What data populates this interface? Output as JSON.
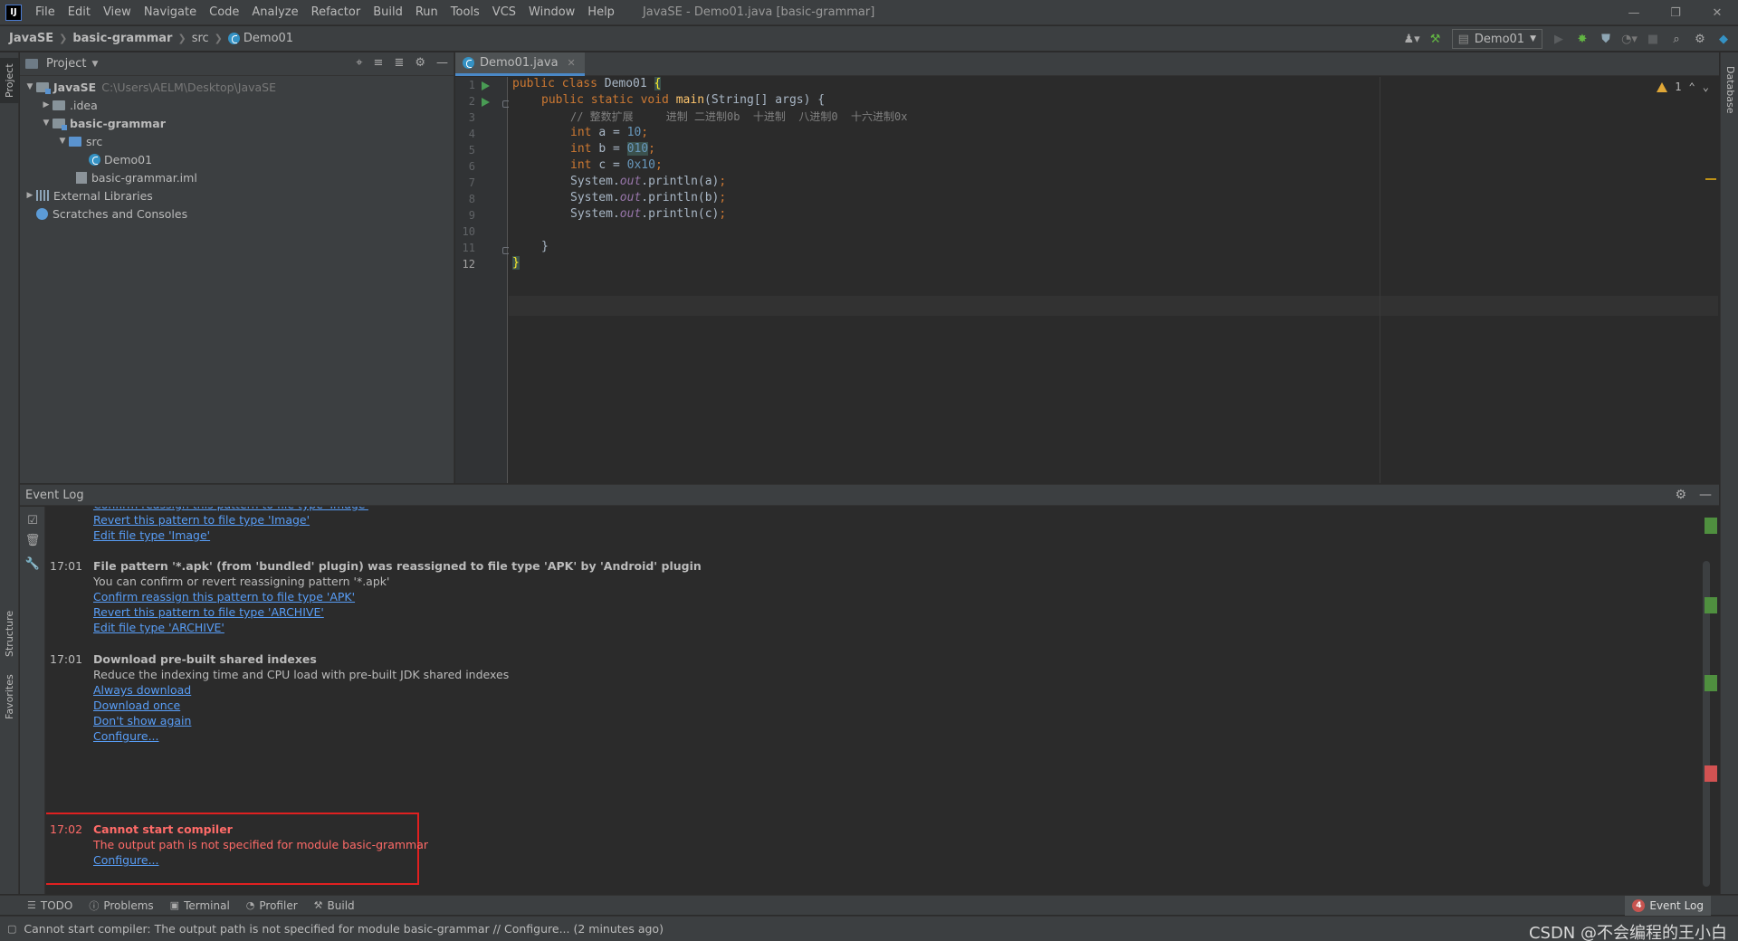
{
  "menubar": {
    "logo": "IJ",
    "items": [
      "File",
      "Edit",
      "View",
      "Navigate",
      "Code",
      "Analyze",
      "Refactor",
      "Build",
      "Run",
      "Tools",
      "VCS",
      "Window",
      "Help"
    ],
    "window_title": "JavaSE - Demo01.java [basic-grammar]"
  },
  "navbar": {
    "crumbs": [
      "JavaSE",
      "basic-grammar",
      "src",
      "Demo01"
    ],
    "run_config": "Demo01"
  },
  "project": {
    "title": "Project",
    "tree": [
      {
        "label": "JavaSE",
        "path": "C:\\Users\\AELM\\Desktop\\JavaSE"
      },
      {
        "label": ".idea"
      },
      {
        "label": "basic-grammar"
      },
      {
        "label": "src"
      },
      {
        "label": "Demo01"
      },
      {
        "label": "basic-grammar.iml"
      },
      {
        "label": "External Libraries"
      },
      {
        "label": "Scratches and Consoles"
      }
    ]
  },
  "editor": {
    "tab_label": "Demo01.java",
    "line_numbers": [
      "1",
      "2",
      "3",
      "4",
      "5",
      "6",
      "7",
      "8",
      "9",
      "10",
      "11",
      "12"
    ],
    "warning_count": "1",
    "code": {
      "l1_kw": "public class ",
      "l1_name": "Demo01 ",
      "l1_brace": "{",
      "l2_kw": "public static void ",
      "l2_fn": "main",
      "l2_rest": "(String[] args) {",
      "l3_cmt": "// 整数扩展     进制 二进制0b  十进制  八进制0  十六进制0x",
      "l4_kw": "int ",
      "l4_mid": "a = ",
      "l4_num": "10",
      "l4_end": ";",
      "l5_kw": "int ",
      "l5_mid": "b = ",
      "l5_num": "010",
      "l5_end": ";",
      "l6_kw": "int ",
      "l6_mid": "c = ",
      "l6_num": "0x10",
      "l6_end": ";",
      "l7_a": "System.",
      "l7_fld": "out",
      "l7_b": ".println(a)",
      "l7_end": ";",
      "l8_a": "System.",
      "l8_fld": "out",
      "l8_b": ".println(b)",
      "l8_end": ";",
      "l9_a": "System.",
      "l9_fld": "out",
      "l9_b": ".println(c)",
      "l9_end": ";",
      "l11": "}",
      "l12": "}"
    }
  },
  "eventlog": {
    "title": "Event Log",
    "entries": {
      "e0_link1": "Confirm reassign this pattern to file type 'Image'",
      "e0_link2": "Revert this pattern to file type 'Image'",
      "e0_link3": "Edit file type 'Image'",
      "e1_time": "17:01",
      "e1_title": "File pattern '*.apk' (from 'bundled' plugin) was reassigned to file type 'APK' by 'Android' plugin",
      "e1_text": "You can confirm or revert reassigning pattern '*.apk'",
      "e1_link1": "Confirm reassign this pattern to file type 'APK'",
      "e1_link2": "Revert this pattern to file type 'ARCHIVE'",
      "e1_link3": "Edit file type 'ARCHIVE'",
      "e2_time": "17:01",
      "e2_title": "Download pre-built shared indexes",
      "e2_text": "Reduce the indexing time and CPU load with pre-built JDK shared indexes",
      "e2_link1": "Always download",
      "e2_link2": "Download once",
      "e2_link3": "Don't show again",
      "e2_link4": "Configure...",
      "e3_time": "17:02",
      "e3_title": "Cannot start compiler",
      "e3_text": "The output path is not specified for module basic-grammar",
      "e3_link1": "Configure..."
    }
  },
  "bottom_tabs": {
    "todo": "TODO",
    "problems": "Problems",
    "terminal": "Terminal",
    "profiler": "Profiler",
    "build": "Build",
    "event_log": "Event Log",
    "event_log_count": "4"
  },
  "stripe": {
    "project": "Project",
    "structure": "Structure",
    "favorites": "Favorites",
    "database": "Database"
  },
  "status": {
    "text": "Cannot start compiler: The output path is not specified for module basic-grammar // Configure... (2 minutes ago)",
    "watermark": "CSDN @不会编程的王小白"
  },
  "colors": {
    "bg_dark": "#2b2b2b",
    "panel": "#3c3f41",
    "link": "#589df6",
    "error": "#ff6b68",
    "highlight_box": "#e02020"
  }
}
